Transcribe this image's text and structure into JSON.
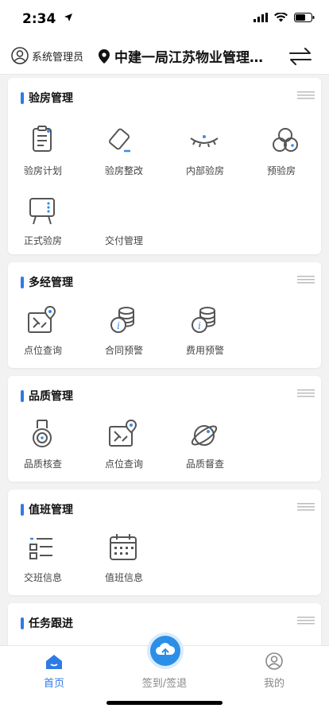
{
  "status_bar": {
    "time": "2:34"
  },
  "header": {
    "user_label": "系统管理员",
    "location_label": "中建一局江苏物业管理有限公司"
  },
  "sections": [
    {
      "title": "验房管理",
      "items": [
        {
          "label": "验房计划",
          "icon": "clipboard-icon"
        },
        {
          "label": "验房整改",
          "icon": "eraser-icon"
        },
        {
          "label": "内部验房",
          "icon": "eye-icon"
        },
        {
          "label": "预验房",
          "icon": "circles-icon"
        },
        {
          "label": "正式验房",
          "icon": "easel-icon"
        },
        {
          "label": "交付管理",
          "icon": ""
        }
      ]
    },
    {
      "title": "多经管理",
      "items": [
        {
          "label": "点位查询",
          "icon": "map-pin-icon"
        },
        {
          "label": "合同预警",
          "icon": "coins-info-icon"
        },
        {
          "label": "费用预警",
          "icon": "coins-info-icon"
        }
      ]
    },
    {
      "title": "品质管理",
      "items": [
        {
          "label": "品质核查",
          "icon": "medal-icon"
        },
        {
          "label": "点位查询",
          "icon": "map-pin-icon"
        },
        {
          "label": "品质督查",
          "icon": "planet-icon"
        }
      ]
    },
    {
      "title": "值班管理",
      "items": [
        {
          "label": "交班信息",
          "icon": "list-icon"
        },
        {
          "label": "值班信息",
          "icon": "calendar-icon"
        }
      ]
    },
    {
      "title": "任务跟进",
      "items": []
    }
  ],
  "tabbar": {
    "home_label": "首页",
    "checkin_label": "签到/签退",
    "mine_label": "我的"
  },
  "colors": {
    "accent": "#2f7be6",
    "icon": "#555555"
  }
}
